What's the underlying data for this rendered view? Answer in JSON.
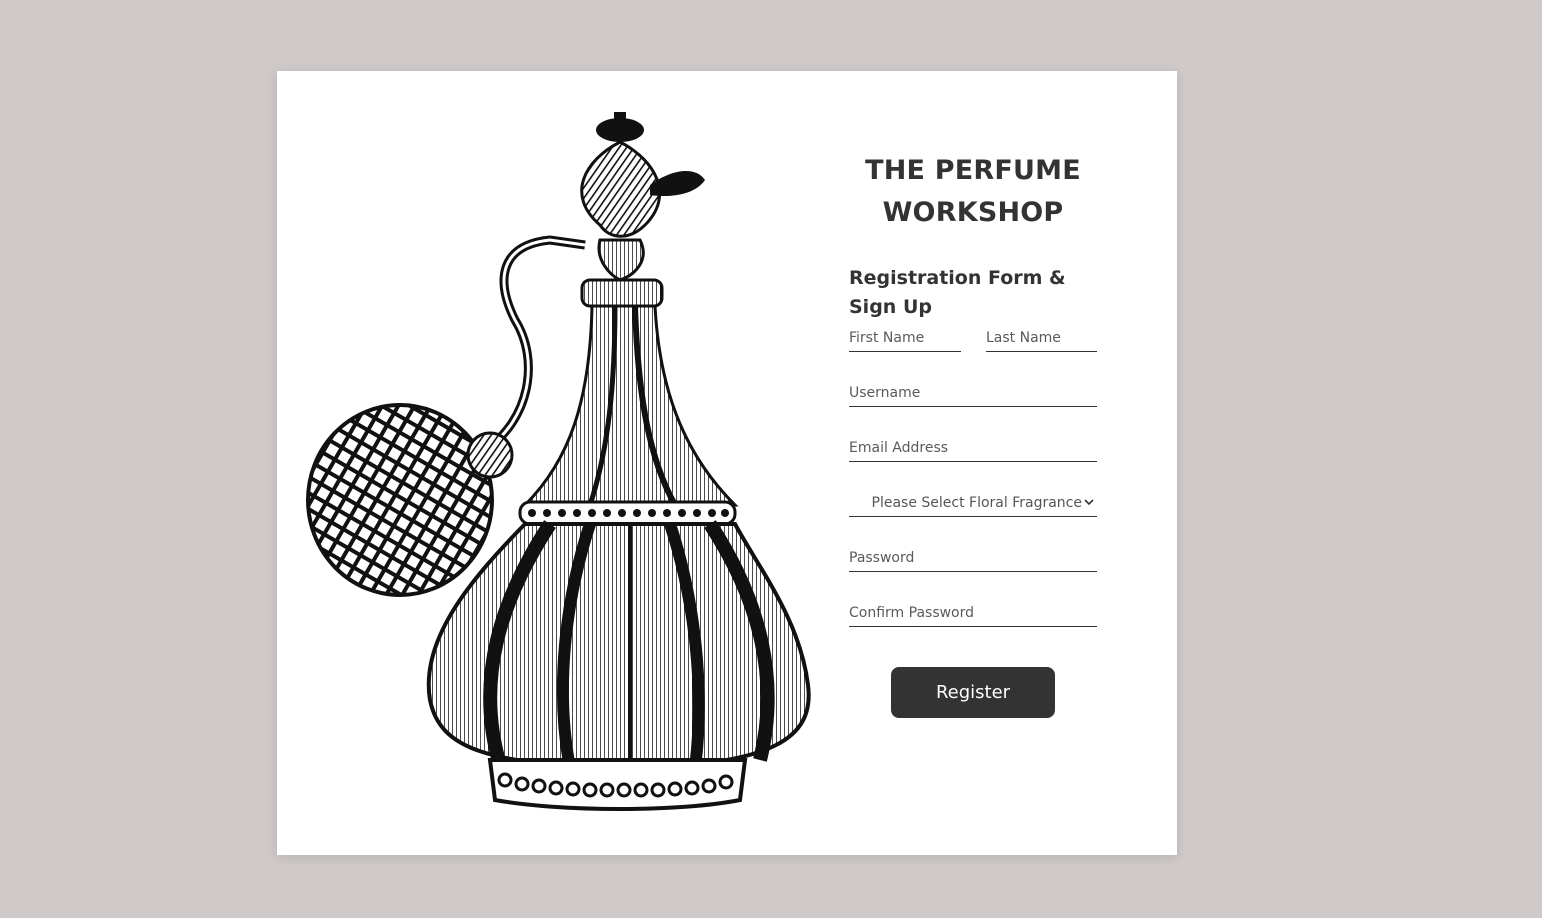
{
  "brand": {
    "title": "THE PERFUME WORKSHOP"
  },
  "form": {
    "heading": "Registration Form & Sign Up",
    "first_name_placeholder": "First Name",
    "last_name_placeholder": "Last Name",
    "username_placeholder": "Username",
    "email_placeholder": "Email Address",
    "fragrance_selected": "Please Select Floral Fragrance",
    "password_placeholder": "Password",
    "confirm_password_placeholder": "Confirm Password",
    "submit_label": "Register"
  },
  "illustration": {
    "icon": "perfume-atomizer-bottle-illustration"
  },
  "colors": {
    "background": "#cfc9c9",
    "card": "#ffffff",
    "text": "#333333",
    "button": "#333333"
  }
}
